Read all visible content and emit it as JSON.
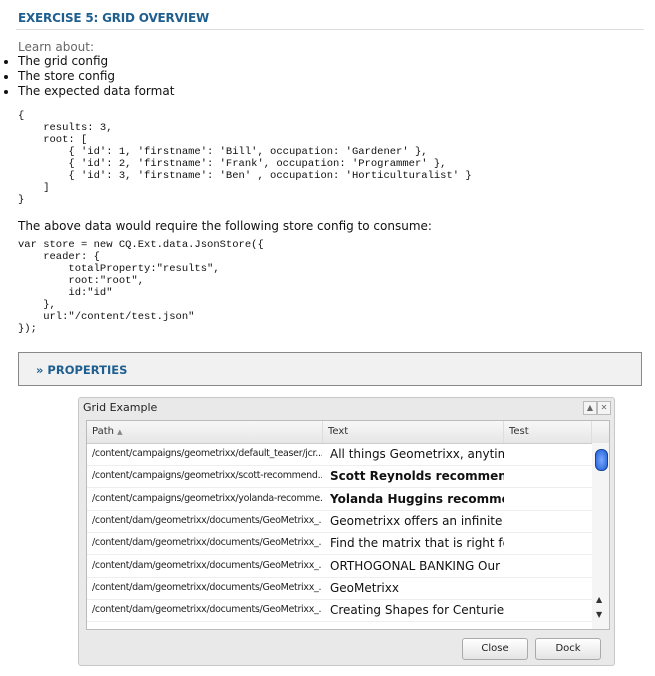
{
  "title": "EXERCISE 5: GRID OVERVIEW",
  "learn": "Learn about:",
  "bullets": [
    "The grid config",
    "The store config",
    "The expected data format"
  ],
  "code1": "{\n    results: 3,\n    root: [\n        { 'id': 1, 'firstname': 'Bill', occupation: 'Gardener' },\n        { 'id': 2, 'firstname': 'Frank', occupation: 'Programmer' },\n        { 'id': 3, 'firstname': 'Ben' , occupation: 'Horticulturalist' }\n    ]\n}",
  "para": "The above data would require the following store config to consume:",
  "code2": "var store = new CQ.Ext.data.JsonStore({\n    reader: {\n        totalProperty:\"results\",\n        root:\"root\",\n        id:\"id\"\n    },\n    url:\"/content/test.json\"\n});",
  "properties": "» PROPERTIES",
  "window": {
    "title": "Grid Example",
    "columns": [
      "Path",
      "Text",
      "Test"
    ],
    "rows": [
      {
        "path": "/content/campaigns/geometrixx/default_teaser/jcr...",
        "text": "All things Geometrixx, anytime",
        "bold": false
      },
      {
        "path": "/content/campaigns/geometrixx/scott-recommend...",
        "text": "Scott Reynolds recommends:",
        "bold": true
      },
      {
        "path": "/content/campaigns/geometrixx/yolanda-recomme...",
        "text": "Yolanda Huggins recommends",
        "bold": true
      },
      {
        "path": "/content/dam/geometrixx/documents/GeoMetrixx_...",
        "text": "Geometrixx offers an infinite v",
        "bold": false
      },
      {
        "path": "/content/dam/geometrixx/documents/GeoMetrixx_...",
        "text": "Find the matrix that is right for",
        "bold": false
      },
      {
        "path": "/content/dam/geometrixx/documents/GeoMetrixx_...",
        "text": "ORTHOGONAL BANKING Our o",
        "bold": false
      },
      {
        "path": "/content/dam/geometrixx/documents/GeoMetrixx_...",
        "text": "GeoMetrixx",
        "bold": false
      },
      {
        "path": "/content/dam/geometrixx/documents/GeoMetrixx_...",
        "text": "Creating Shapes for Centuries",
        "bold": false
      }
    ],
    "close": "Close",
    "dock": "Dock"
  }
}
